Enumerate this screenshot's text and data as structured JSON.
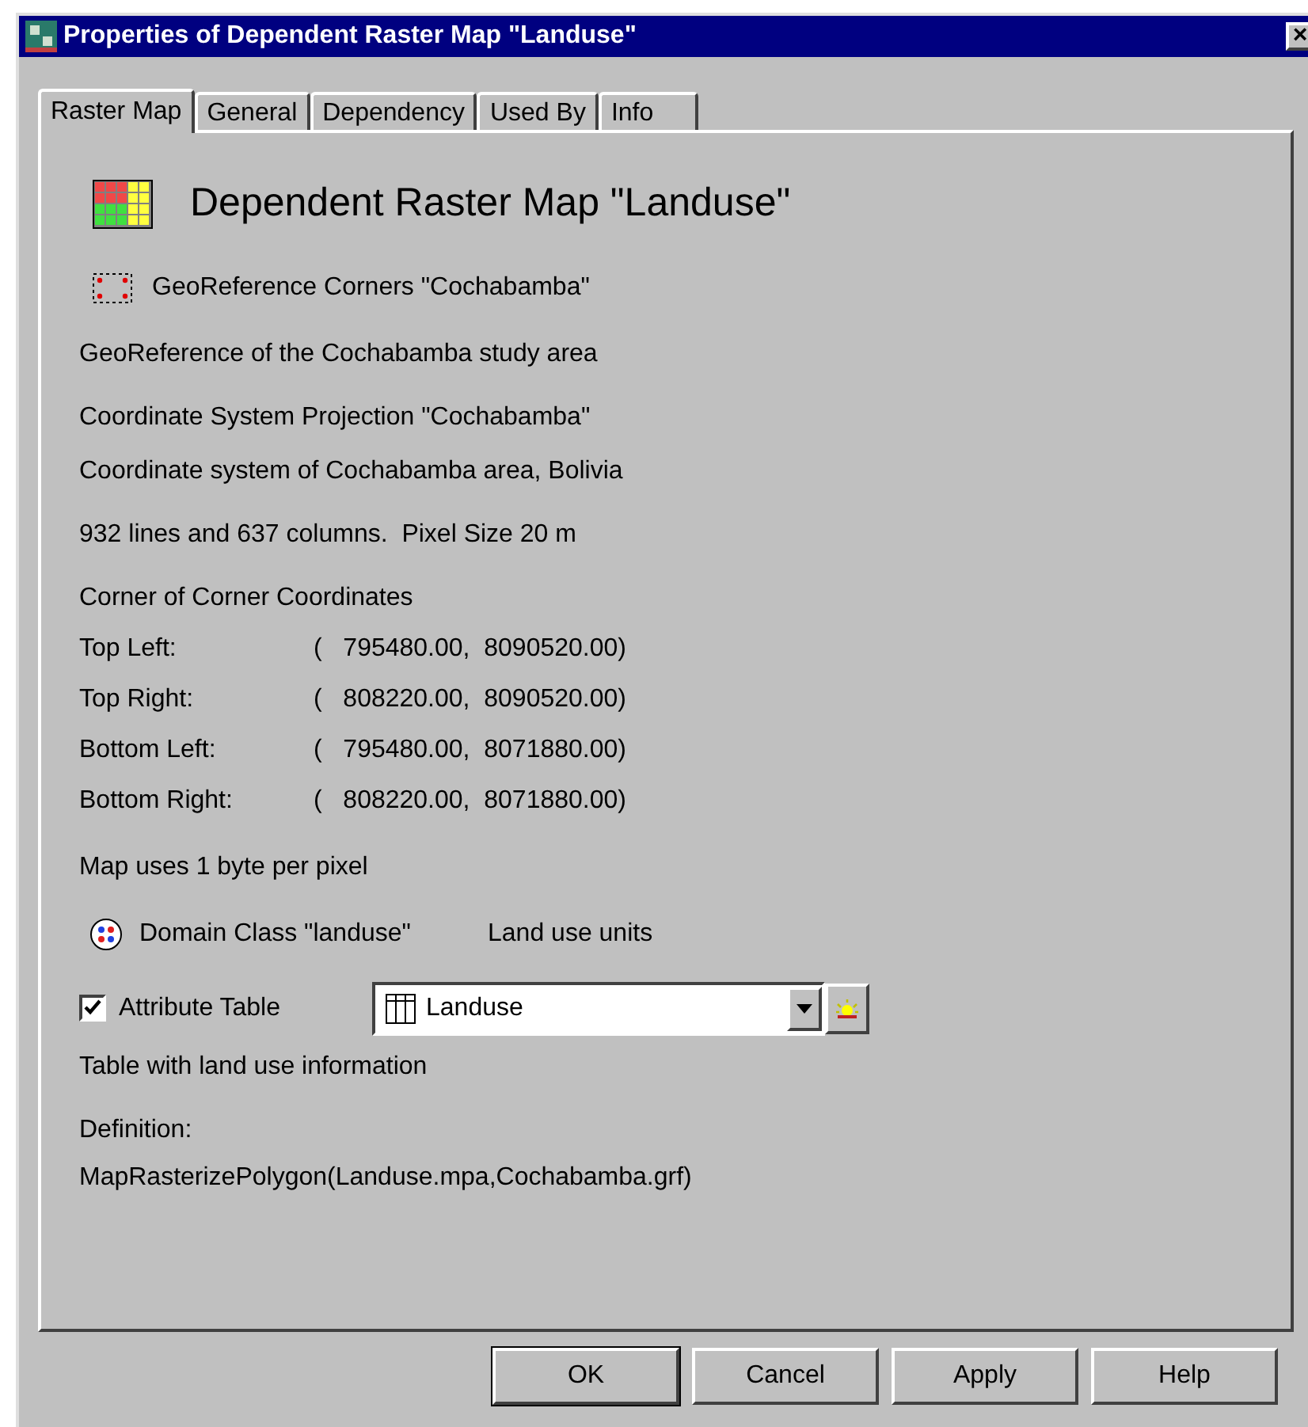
{
  "window": {
    "title": "Properties of Dependent Raster Map \"Landuse\"",
    "close": "×"
  },
  "tabs": [
    {
      "label": "Raster Map",
      "selected": true
    },
    {
      "label": "General",
      "selected": false
    },
    {
      "label": "Dependency",
      "selected": false
    },
    {
      "label": "Used By",
      "selected": false
    },
    {
      "label": "Info",
      "selected": false
    }
  ],
  "heading": "Dependent Raster Map \"Landuse\"",
  "georeference": {
    "name": "GeoReference Corners \"Cochabamba\"",
    "description": "GeoReference of the Cochabamba study area"
  },
  "coordinate_system": {
    "name": "Coordinate System Projection \"Cochabamba\"",
    "description": "Coordinate system of Cochabamba area, Bolivia"
  },
  "size_info": "932 lines and 637 columns.  Pixel Size 20 m",
  "corners": {
    "title": "Corner of Corner Coordinates",
    "rows": [
      {
        "label": "Top Left:",
        "value": "(   795480.00,  8090520.00)"
      },
      {
        "label": "Top Right:",
        "value": "(   808220.00,  8090520.00)"
      },
      {
        "label": "Bottom Left:",
        "value": "(   795480.00,  8071880.00)"
      },
      {
        "label": "Bottom Right:",
        "value": "(   808220.00,  8071880.00)"
      }
    ]
  },
  "storage": "Map uses 1 byte per pixel",
  "domain": {
    "name": "Domain Class \"landuse\"",
    "description": "Land use units"
  },
  "attribute_table": {
    "label": "Attribute Table",
    "checked": true,
    "value": "Landuse",
    "description": "Table with land use information"
  },
  "definition": {
    "label": "Definition:",
    "expression": "MapRasterizePolygon(Landuse.mpa,Cochabamba.grf)"
  },
  "buttons": [
    "OK",
    "Cancel",
    "Apply",
    "Help"
  ]
}
